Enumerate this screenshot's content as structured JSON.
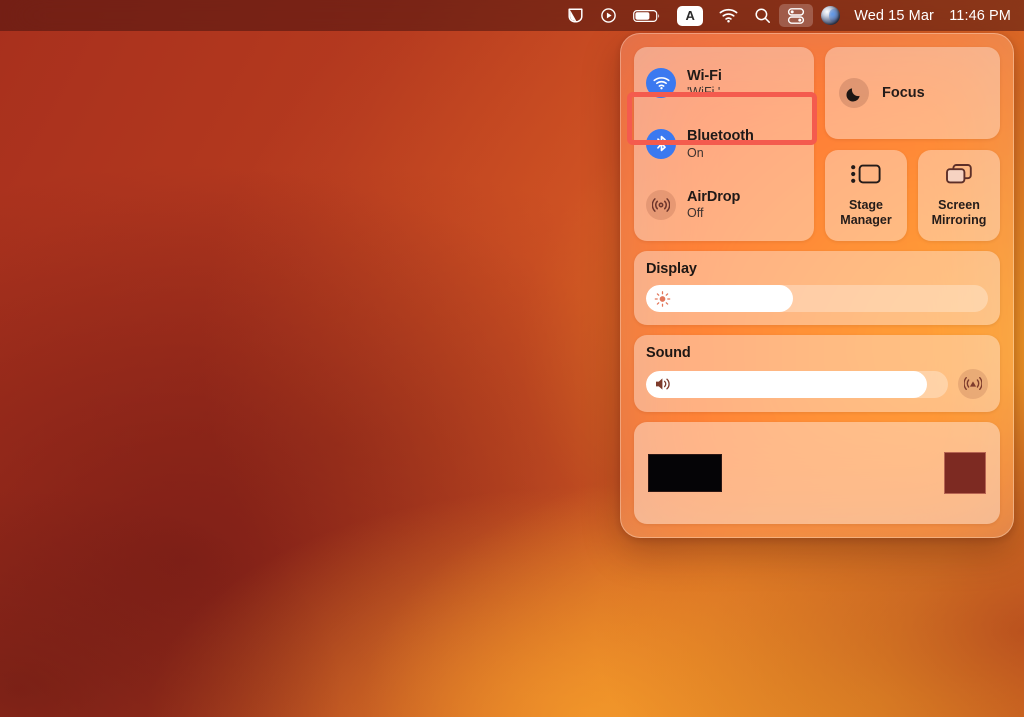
{
  "menubar": {
    "icons": [
      {
        "name": "cleanshot-icon",
        "label": "CleanShot"
      },
      {
        "name": "screen-record-icon",
        "label": "Screen Recording"
      },
      {
        "name": "battery-icon",
        "label": "Battery"
      },
      {
        "name": "input-source-icon",
        "label": "A"
      },
      {
        "name": "wifi-icon",
        "label": "Wi-Fi"
      },
      {
        "name": "search-icon",
        "label": "Spotlight Search"
      },
      {
        "name": "control-center-icon",
        "label": "Control Center"
      },
      {
        "name": "siri-icon",
        "label": "Siri"
      }
    ],
    "input_source_letter": "A",
    "clock_date": "Wed 15 Mar",
    "clock_time": "11:46 PM"
  },
  "control_center": {
    "connectivity": {
      "items": [
        {
          "title": "Wi-Fi",
          "subtitle": "'WiFi '",
          "state": "on",
          "icon": "wifi-icon"
        },
        {
          "title": "Bluetooth",
          "subtitle": "On",
          "state": "on",
          "icon": "bluetooth-icon"
        },
        {
          "title": "AirDrop",
          "subtitle": "Off",
          "state": "off",
          "icon": "airdrop-icon"
        }
      ]
    },
    "focus": {
      "label": "Focus",
      "icon": "moon-icon"
    },
    "stage_manager": {
      "label_line1": "Stage",
      "label_line2": "Manager",
      "icon": "stage-manager-icon"
    },
    "screen_mirroring": {
      "label_line1": "Screen",
      "label_line2": "Mirroring",
      "icon": "screen-mirroring-icon"
    },
    "display": {
      "title": "Display",
      "value": 43,
      "icon": "brightness-icon"
    },
    "sound": {
      "title": "Sound",
      "value": 93,
      "icon": "volume-icon",
      "airplay_icon": "airplay-icon"
    },
    "now_playing": {
      "artwork": "",
      "thumbnail": ""
    }
  },
  "annotation": {
    "highlight_target": "Bluetooth",
    "color": "#f45b4e"
  }
}
